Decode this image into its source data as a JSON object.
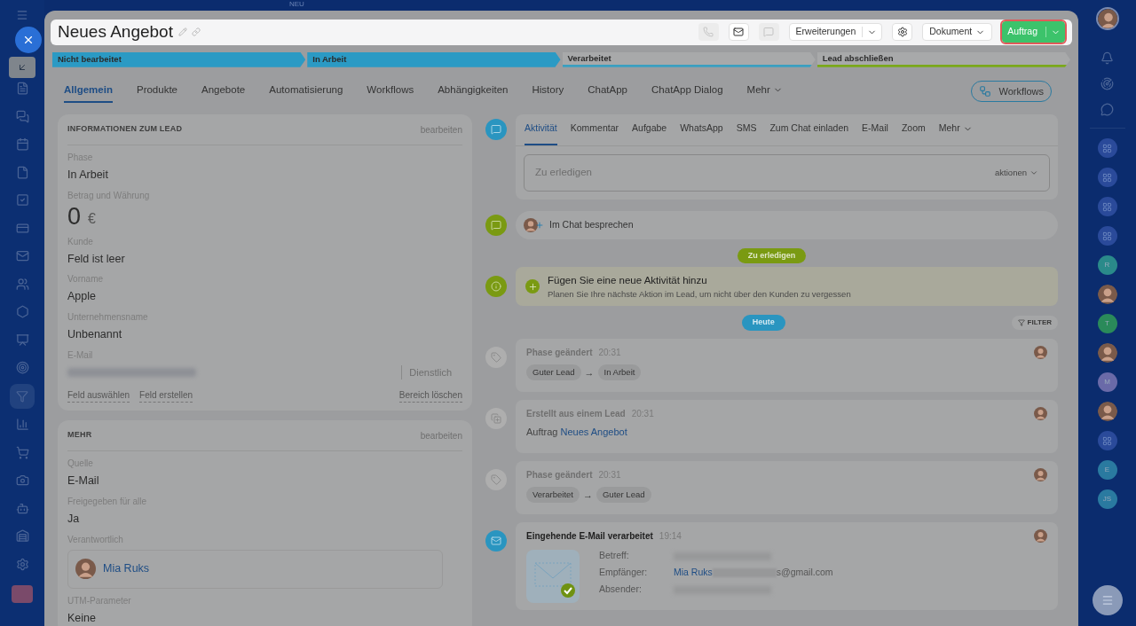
{
  "background_label": "NEU",
  "header": {
    "title": "Neues Angebot",
    "buttons": [
      {
        "kind": "icon",
        "disabled": true
      },
      {
        "kind": "icon",
        "disabled": false
      },
      {
        "kind": "icon",
        "disabled": true
      },
      {
        "kind": "split",
        "label": "Erweiterungen"
      },
      {
        "kind": "icon",
        "disabled": false
      },
      {
        "kind": "dropdown",
        "label": "Dokument"
      },
      {
        "kind": "primary",
        "label": "Auftrag"
      }
    ]
  },
  "stages": [
    {
      "label": "Nicht bearbeitet",
      "reached": true,
      "color": "#2b9ac4"
    },
    {
      "label": "In Arbeit",
      "reached": true,
      "color": "#2b9ac4"
    },
    {
      "label": "Verarbeitet",
      "reached": false,
      "color": "#3a9fc0"
    },
    {
      "label": "Lead abschließen",
      "reached": false,
      "color": "#7aa81a"
    }
  ],
  "tabs": [
    {
      "label": "Allgemein",
      "selected": true
    },
    {
      "label": "Produkte",
      "selected": false
    },
    {
      "label": "Angebote",
      "selected": false
    },
    {
      "label": "Automatisierung",
      "selected": false
    },
    {
      "label": "Workflows",
      "selected": false
    },
    {
      "label": "Abhängigkeiten",
      "selected": false
    },
    {
      "label": "History",
      "selected": false
    },
    {
      "label": "ChatApp",
      "selected": false
    },
    {
      "label": "ChatApp Dialog",
      "selected": false
    },
    {
      "label": "Mehr",
      "selected": false
    }
  ],
  "workflows_button": "Workflows",
  "info_card": {
    "title": "INFORMATIONEN ZUM LEAD",
    "edit": "bearbeiten",
    "fields": [
      {
        "kind": "text",
        "label": "Phase",
        "value": "In Arbeit"
      },
      {
        "kind": "amount",
        "label": "Betrag und Währung",
        "value": "0",
        "currency": "€"
      },
      {
        "kind": "text",
        "label": "Kunde",
        "value": "Feld ist leer"
      },
      {
        "kind": "text",
        "label": "Vorname",
        "value": "Apple"
      },
      {
        "kind": "text",
        "label": "Unternehmensname",
        "value": "Unbenannt"
      },
      {
        "kind": "email",
        "label": "E-Mail",
        "type": "Dienstlich"
      }
    ],
    "links": [
      "Feld auswählen",
      "Feld erstellen"
    ],
    "clear": "Bereich löschen"
  },
  "more_card": {
    "title": "MEHR",
    "edit": "bearbeiten",
    "fields": [
      {
        "kind": "text",
        "label": "Quelle",
        "value": "E-Mail"
      },
      {
        "kind": "text",
        "label": "Freigegeben für alle",
        "value": "Ja"
      },
      {
        "kind": "user",
        "label": "Verantwortlich",
        "value": "Mia Ruks"
      },
      {
        "kind": "text",
        "label": "UTM-Parameter",
        "value": "Keine"
      }
    ]
  },
  "activity": {
    "tabs": [
      {
        "label": "Aktivität",
        "selected": true
      },
      {
        "label": "Kommentar",
        "selected": false
      },
      {
        "label": "Aufgabe",
        "selected": false
      },
      {
        "label": "WhatsApp",
        "selected": false
      },
      {
        "label": "SMS",
        "selected": false
      },
      {
        "label": "Zum Chat einladen",
        "selected": false
      },
      {
        "label": "E-Mail",
        "selected": false
      },
      {
        "label": "Zoom",
        "selected": false
      },
      {
        "label": "Mehr",
        "selected": false
      }
    ],
    "placeholder": "Zu erledigen",
    "actions": "aktionen"
  },
  "chat_prompt": "Im Chat besprechen",
  "todo_badge": "Zu erledigen",
  "hint": {
    "title": "Fügen Sie eine neue Aktivität hinzu",
    "text": "Planen Sie Ihre nächste Aktion im Lead, um nicht über den Kunden zu vergessen"
  },
  "today_badge": "Heute",
  "filter": "FILTER",
  "history": [
    {
      "kind": "phase",
      "title": "Phase geändert",
      "time": "20:31",
      "from": "Guter Lead",
      "arrow": "→",
      "to": "In Arbeit"
    },
    {
      "kind": "created",
      "title": "Erstellt aus einem Lead",
      "time": "20:31",
      "label": "Auftrag",
      "link": "Neues Angebot"
    },
    {
      "kind": "phase",
      "title": "Phase geändert",
      "time": "20:31",
      "from": "Verarbeitet",
      "arrow": "→",
      "to": "Guter Lead"
    },
    {
      "kind": "email",
      "title": "Eingehende E-Mail verarbeitet",
      "time": "19:14",
      "fields": [
        {
          "label": "Betreff:"
        },
        {
          "label": "Empfänger:",
          "name": "Mia Ruks",
          "value": "s@gmail.com"
        },
        {
          "label": "Absender:"
        }
      ]
    }
  ],
  "right_rail": [
    {
      "kind": "icon"
    },
    {
      "kind": "icon"
    },
    {
      "kind": "icon"
    },
    {
      "kind": "icon"
    },
    {
      "kind": "letter",
      "text": "R",
      "color": "#2a8a8a"
    },
    {
      "kind": "avatar"
    },
    {
      "kind": "letter",
      "text": "T",
      "color": "#2a8a5a"
    },
    {
      "kind": "avatar"
    },
    {
      "kind": "letter",
      "text": "M",
      "color": "#6a6aa8"
    },
    {
      "kind": "avatar"
    },
    {
      "kind": "icon"
    },
    {
      "kind": "letter",
      "text": "E",
      "color": "#2a7aa0"
    },
    {
      "kind": "letter",
      "text": "JS",
      "color": "#2a7aa0"
    }
  ]
}
